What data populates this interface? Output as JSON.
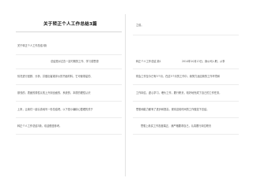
{
  "document": {
    "title": "关于转正个人工作总结3篇",
    "left_intro": "关于转正个人工作总结3篇",
    "left_lines": [
      "总结是对过去一定时期的工作、学习或思想",
      "情况进行回顾、分析，并做出客观评价的书面材料，它可使零星的、",
      "肤浅的、表面的感性认知上升到全面的、系统的、本质的理性认识",
      "上来，让我们一起认真地写一份总结吧。以下是小编精心整理的关于",
      "转正个人工作总结3篇，欢迎借鉴参考。"
    ],
    "right_top": "之前。",
    "right_heading": "转正个人工作总结 篇1",
    "right_lines": [
      "2014年10月13日，我公司入职，从事",
      "财会工作至今已有3个月，在这3个月的工作中，我努力适应新的工作环境和",
      "工作岗位，虚心学习，埋头工作，履行职责，较好地完成了自己的工作任务，",
      "思想和能力都有了进步和提高，现将这段时间的工作做如下总结。",
      "思想上着实工作态度端正，我严格要求自己，认真履行岗位职责"
    ]
  }
}
